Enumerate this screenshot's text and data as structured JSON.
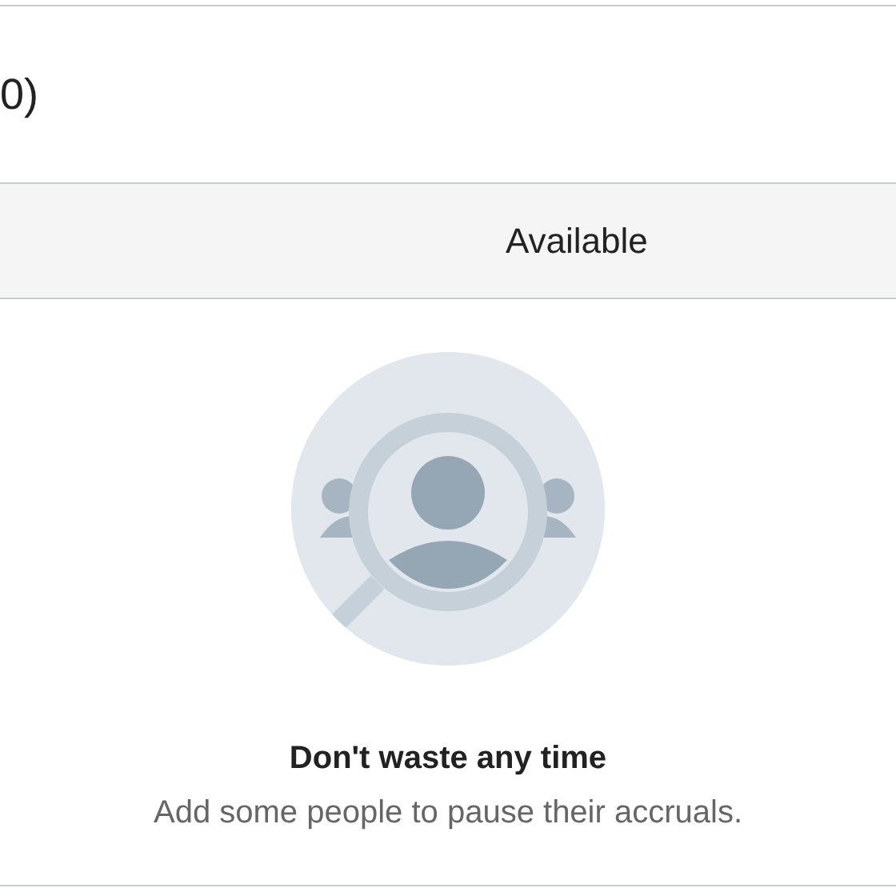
{
  "heading": {
    "text": "0)"
  },
  "table": {
    "columns": [
      "Available"
    ]
  },
  "empty_state": {
    "title": "Don't waste any time",
    "message": "Add some people to pause their accruals."
  }
}
